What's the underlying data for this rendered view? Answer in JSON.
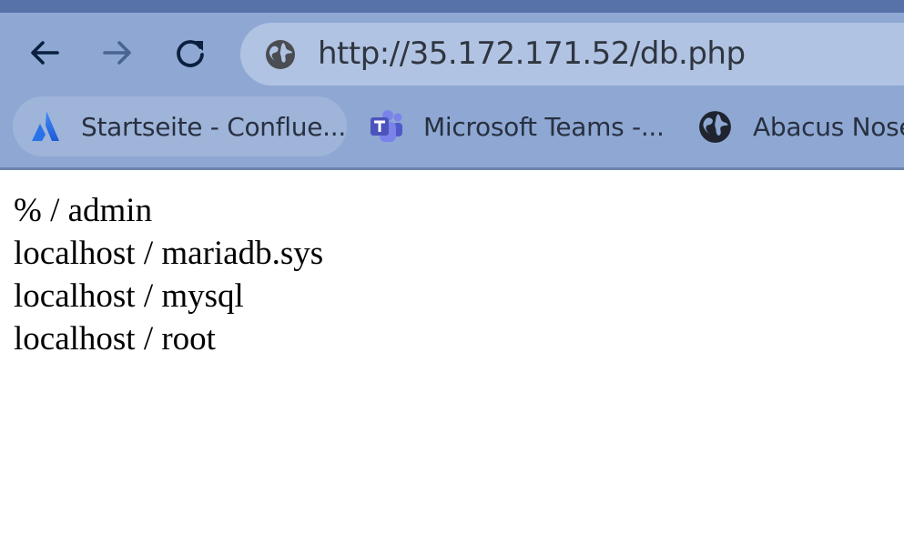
{
  "browser": {
    "nav": {
      "back": "back-icon",
      "forward": "forward-icon",
      "reload": "reload-icon"
    },
    "address_bar": {
      "url": "http://35.172.171.52/db.php",
      "site_icon": "globe-icon"
    },
    "bookmarks": [
      {
        "label": "Startseite - Conflue...",
        "icon": "confluence-icon"
      },
      {
        "label": "Microsoft Teams -...",
        "icon": "teams-icon"
      },
      {
        "label": "Abacus Nose",
        "icon": "globe-icon"
      }
    ],
    "colors": {
      "toolbar": "#8ea8d3",
      "omnibox": "#b1c3e3",
      "top_strip": "#5672a9"
    }
  },
  "page": {
    "lines": [
      "% / admin",
      "localhost / mariadb.sys",
      "localhost / mysql",
      "localhost / root"
    ]
  }
}
